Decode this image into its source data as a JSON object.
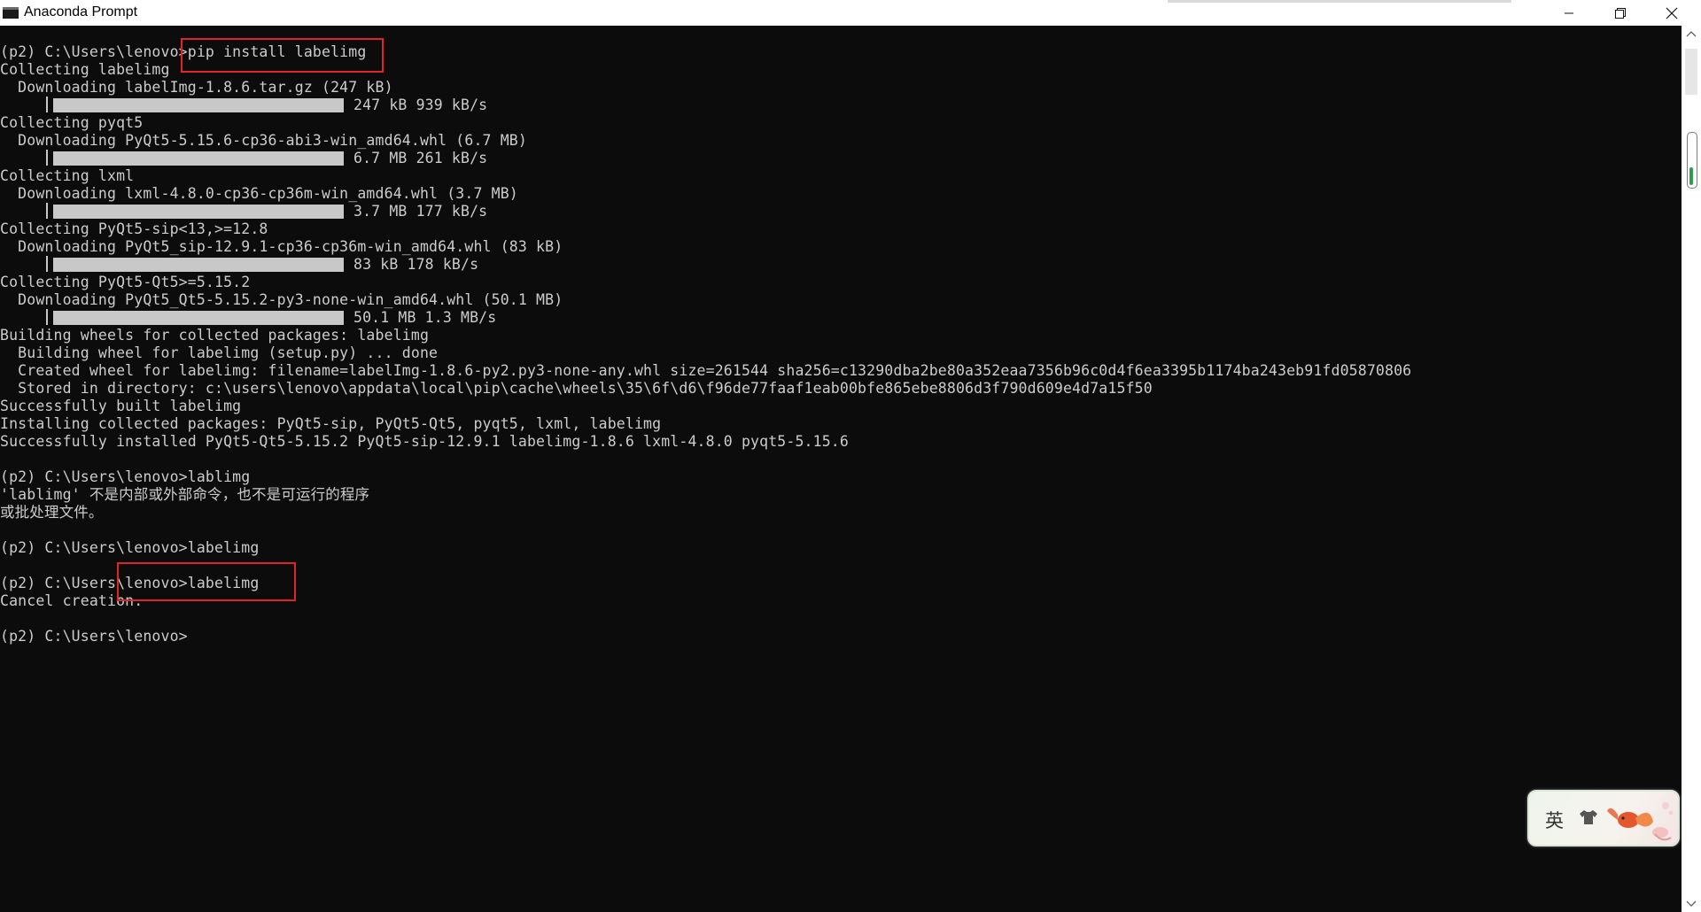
{
  "window": {
    "title": "Anaconda Prompt"
  },
  "console": {
    "lines": [
      "(p2) C:\\Users\\lenovo>pip install labelimg",
      "Collecting labelimg",
      "  Downloading labelImg-1.8.6.tar.gz (247 kB)",
      "",
      "Collecting pyqt5",
      "  Downloading PyQt5-5.15.6-cp36-abi3-win_amd64.whl (6.7 MB)",
      "",
      "Collecting lxml",
      "  Downloading lxml-4.8.0-cp36-cp36m-win_amd64.whl (3.7 MB)",
      "",
      "Collecting PyQt5-sip<13,>=12.8",
      "  Downloading PyQt5_sip-12.9.1-cp36-cp36m-win_amd64.whl (83 kB)",
      "",
      "Collecting PyQt5-Qt5>=5.15.2",
      "  Downloading PyQt5_Qt5-5.15.2-py3-none-win_amd64.whl (50.1 MB)",
      "",
      "Building wheels for collected packages: labelimg",
      "  Building wheel for labelimg (setup.py) ... done",
      "  Created wheel for labelimg: filename=labelImg-1.8.6-py2.py3-none-any.whl size=261544 sha256=c13290dba2be80a352eaa7356b96c0d4f6ea3395b1174ba243eb91fd05870806",
      "  Stored in directory: c:\\users\\lenovo\\appdata\\local\\pip\\cache\\wheels\\35\\6f\\d6\\f96de77faaf1eab00bfe865ebe8806d3f790d609e4d7a15f50",
      "Successfully built labelimg",
      "Installing collected packages: PyQt5-sip, PyQt5-Qt5, pyqt5, lxml, labelimg",
      "Successfully installed PyQt5-Qt5-5.15.2 PyQt5-sip-12.9.1 labelimg-1.8.6 lxml-4.8.0 pyqt5-5.15.6",
      "",
      "(p2) C:\\Users\\lenovo>lablimg",
      "'lablimg' 不是内部或外部命令，也不是可运行的程序",
      "或批处理文件。",
      "",
      "(p2) C:\\Users\\lenovo>labelimg",
      "",
      "(p2) C:\\Users\\lenovo>labelimg",
      "Cancel creation.",
      "",
      "(p2) C:\\Users\\lenovo>"
    ],
    "progress_bars": [
      {
        "label": "247 kB 939 kB/s",
        "fraction": 1.0
      },
      {
        "label": "6.7 MB 261 kB/s",
        "fraction": 1.0
      },
      {
        "label": "3.7 MB 177 kB/s",
        "fraction": 1.0
      },
      {
        "label": "83 kB 178 kB/s",
        "fraction": 1.0
      },
      {
        "label": "50.1 MB 1.3 MB/s",
        "fraction": 1.0
      }
    ]
  },
  "ime": {
    "language": "英",
    "icons": [
      "shirt-icon",
      "goldfish-icon"
    ]
  },
  "colors": {
    "console_background": "#0c0c0c",
    "console_text": "#cccccc",
    "highlight_box": "#e0242b"
  }
}
